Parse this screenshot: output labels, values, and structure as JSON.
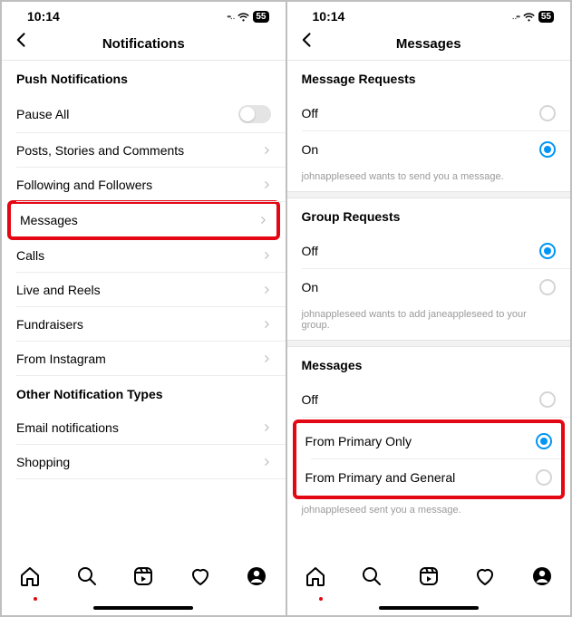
{
  "statusbar": {
    "time": "10:14",
    "battery": "55"
  },
  "left": {
    "title": "Notifications",
    "push_header": "Push Notifications",
    "pause_all": "Pause All",
    "rows": {
      "posts": "Posts, Stories and Comments",
      "following": "Following and Followers",
      "messages": "Messages",
      "calls": "Calls",
      "live": "Live and Reels",
      "fundraisers": "Fundraisers",
      "from_ig": "From Instagram"
    },
    "other_header": "Other Notification Types",
    "email": "Email notifications",
    "shopping": "Shopping"
  },
  "right": {
    "title": "Messages",
    "sections": {
      "message_requests": {
        "header": "Message Requests",
        "off": "Off",
        "on": "On",
        "hint": "johnappleseed wants to send you a message."
      },
      "group_requests": {
        "header": "Group Requests",
        "off": "Off",
        "on": "On",
        "hint": "johnappleseed wants to add janeappleseed to your group."
      },
      "messages": {
        "header": "Messages",
        "off": "Off",
        "primary": "From Primary Only",
        "primary_general": "From Primary and General",
        "hint": "johnappleseed sent you a message."
      }
    }
  }
}
